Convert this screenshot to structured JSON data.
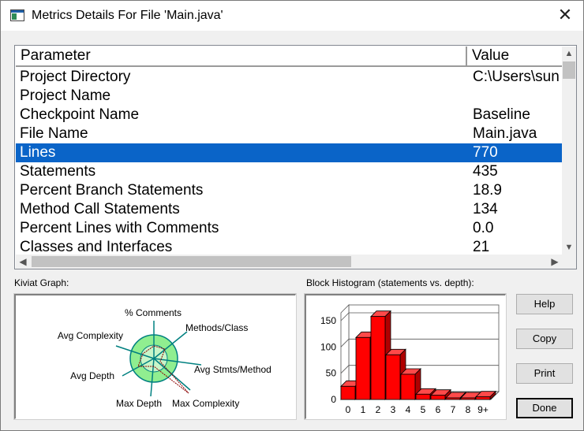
{
  "window": {
    "title": "Metrics Details For File 'Main.java'",
    "close_glyph": "✕"
  },
  "table": {
    "headers": [
      "Parameter",
      "Value"
    ],
    "rows": [
      {
        "parameter": "Project Directory",
        "value": "C:\\Users\\sun"
      },
      {
        "parameter": "Project Name",
        "value": ""
      },
      {
        "parameter": "Checkpoint Name",
        "value": "Baseline"
      },
      {
        "parameter": "File Name",
        "value": "Main.java"
      },
      {
        "parameter": "Lines",
        "value": "770",
        "selected": true
      },
      {
        "parameter": "Statements",
        "value": "435"
      },
      {
        "parameter": "Percent Branch Statements",
        "value": "18.9"
      },
      {
        "parameter": "Method Call Statements",
        "value": "134"
      },
      {
        "parameter": "Percent Lines with Comments",
        "value": "0.0"
      },
      {
        "parameter": "Classes and Interfaces",
        "value": "21"
      }
    ],
    "selected_color": "#0a64c8"
  },
  "kiviat": {
    "label": "Kiviat Graph:",
    "axes": [
      "% Comments",
      "Methods/Class",
      "Avg Stmts/Method",
      "Max Complexity",
      "Max Depth",
      "Avg Depth",
      "Avg Complexity"
    ],
    "ring_colors": {
      "outer": "#90ee90",
      "inner": "#c8f5c8",
      "line": "#008080",
      "value_line": "#8b0000"
    }
  },
  "histogram": {
    "label": "Block Histogram (statements vs. depth):",
    "bar_color": "#ff0000"
  },
  "chart_data": {
    "type": "bar",
    "categories": [
      "0",
      "1",
      "2",
      "3",
      "4",
      "5",
      "6",
      "7",
      "8",
      "9+"
    ],
    "values": [
      25,
      118,
      158,
      85,
      48,
      10,
      8,
      3,
      3,
      5
    ],
    "ylim": [
      0,
      165
    ],
    "yticks": [
      0,
      50,
      100,
      150
    ]
  },
  "buttons": {
    "help": "Help",
    "copy": "Copy",
    "print": "Print",
    "done": "Done"
  }
}
